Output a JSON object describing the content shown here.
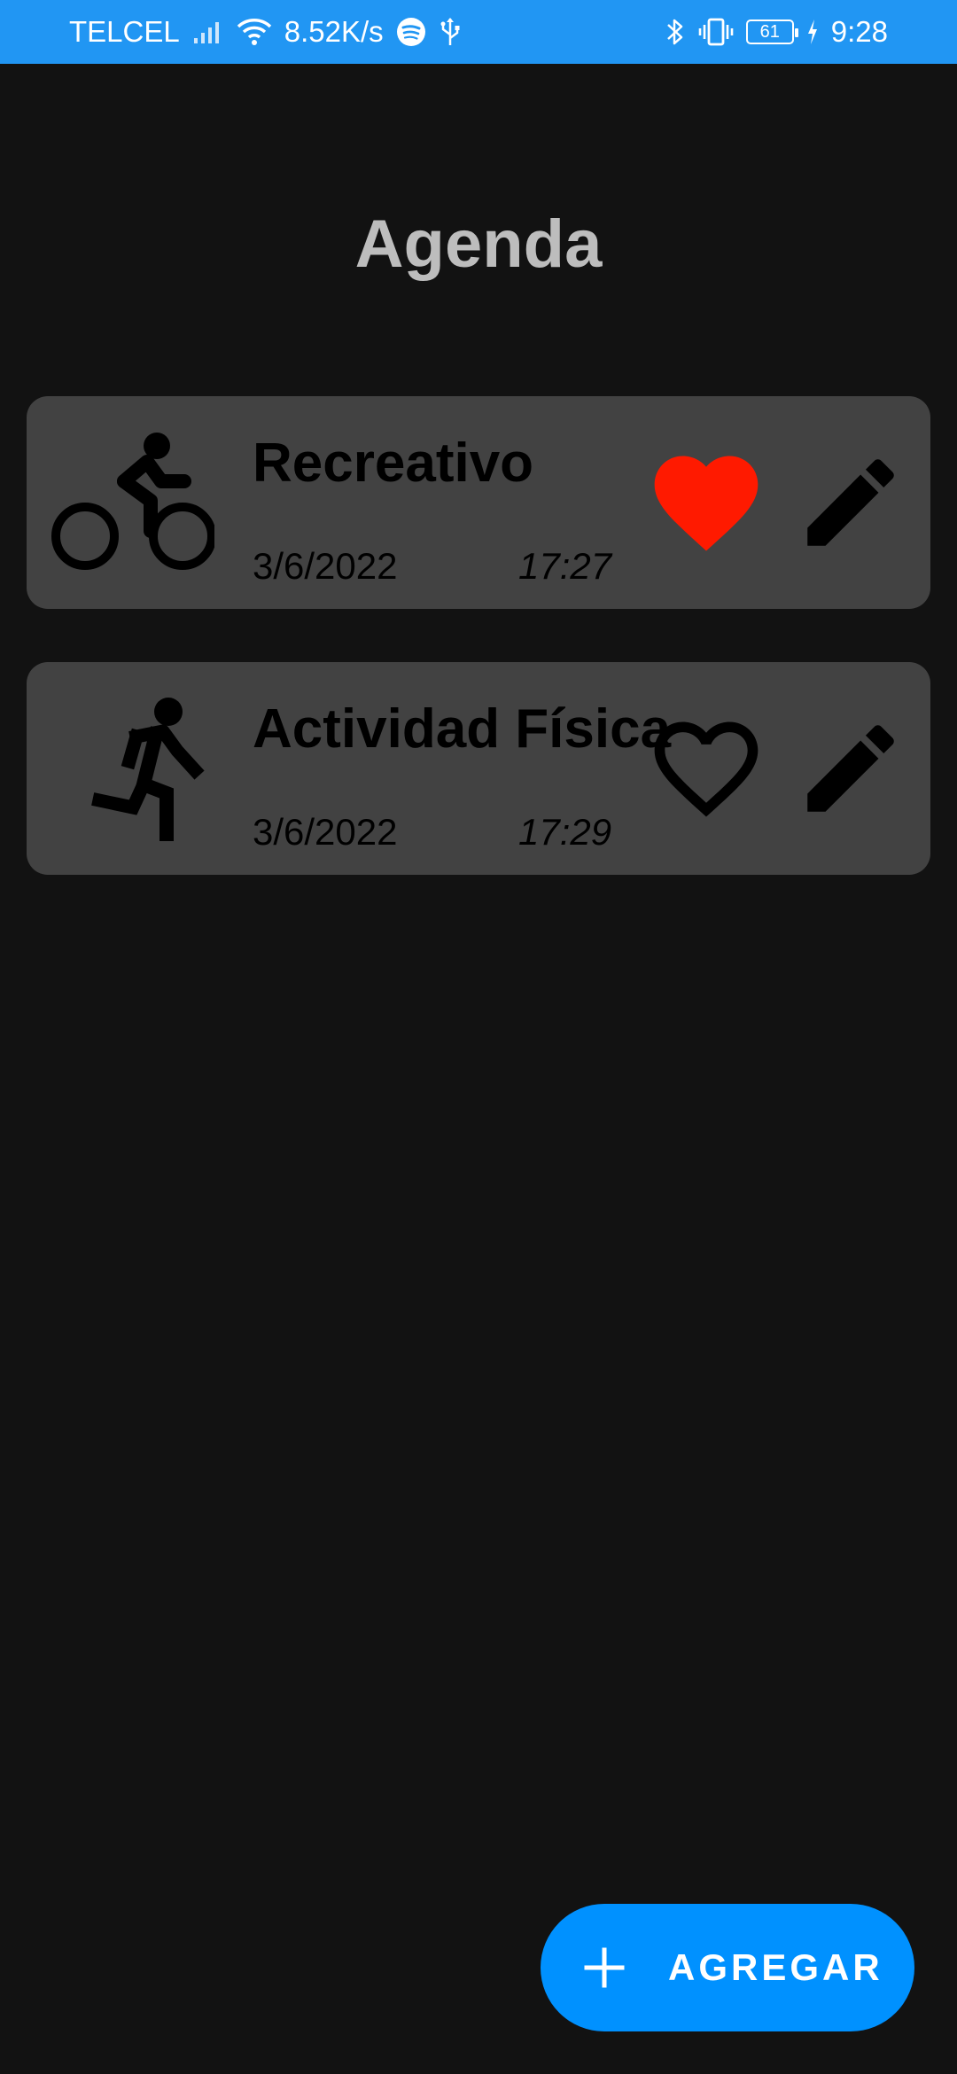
{
  "status_bar": {
    "carrier": "TELCEL",
    "net_speed": "8.52K/s",
    "battery_level": "61",
    "time": "9:28",
    "icons": [
      "signal-icon",
      "wifi-icon",
      "spotify-icon",
      "usb-icon",
      "bluetooth-icon",
      "vibrate-icon",
      "battery-icon",
      "charging-icon"
    ]
  },
  "page": {
    "title": "Agenda"
  },
  "entries": [
    {
      "title": "Recreativo",
      "date": "3/6/2022",
      "time": "17:27",
      "icon": "bike-icon",
      "favorite": true
    },
    {
      "title": "Actividad Física",
      "date": "3/6/2022",
      "time": "17:29",
      "icon": "run-icon",
      "favorite": false
    }
  ],
  "fab": {
    "label": "AGREGAR",
    "icon": "plus-icon"
  },
  "colors": {
    "status_bar": "#2196F3",
    "background": "#121212",
    "card": "#424242",
    "title": "#BDBDBD",
    "favorite": "#FF1A00",
    "fab": "#0091FF"
  }
}
